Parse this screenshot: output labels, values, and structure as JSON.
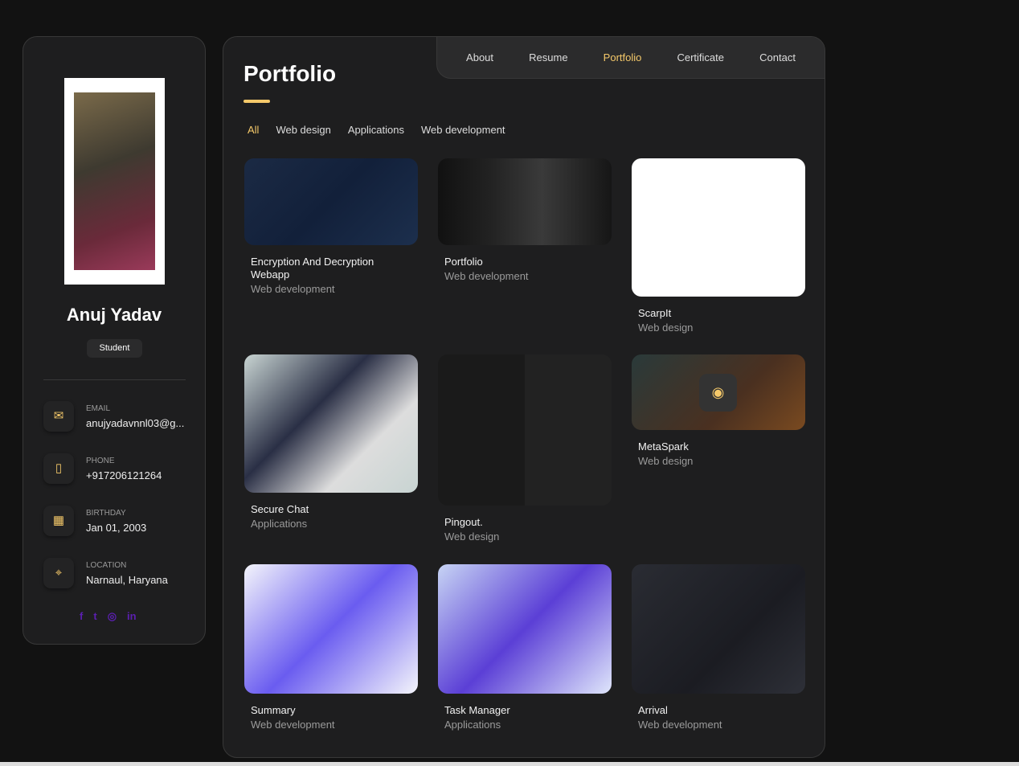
{
  "sidebar": {
    "name": "Anuj Yadav",
    "role": "Student",
    "contacts": [
      {
        "icon": "mail-icon",
        "glyph": "✉",
        "label": "EMAIL",
        "value": "anujyadavnnl03@g..."
      },
      {
        "icon": "phone-icon",
        "glyph": "▯",
        "label": "PHONE",
        "value": "+917206121264"
      },
      {
        "icon": "calendar-icon",
        "glyph": "▦",
        "label": "BIRTHDAY",
        "value": "Jan 01, 2003"
      },
      {
        "icon": "location-icon",
        "glyph": "⌖",
        "label": "LOCATION",
        "value": "Narnaul, Haryana"
      }
    ],
    "social": [
      {
        "icon": "facebook-icon",
        "glyph": "f"
      },
      {
        "icon": "twitter-icon",
        "glyph": "t"
      },
      {
        "icon": "instagram-icon",
        "glyph": "◎"
      },
      {
        "icon": "linkedin-icon",
        "glyph": "in"
      }
    ]
  },
  "nav": [
    "About",
    "Resume",
    "Portfolio",
    "Certificate",
    "Contact"
  ],
  "nav_active": "Portfolio",
  "title": "Portfolio",
  "filters": [
    "All",
    "Web design",
    "Applications",
    "Web development"
  ],
  "filter_active": "All",
  "accent": "#f5c96a",
  "projects": [
    {
      "title": "Encryption And Decryption Webapp",
      "category": "Web development"
    },
    {
      "title": "Portfolio",
      "category": "Web development"
    },
    {
      "title": "ScarpIt",
      "category": "Web design"
    },
    {
      "title": "Secure Chat",
      "category": "Applications"
    },
    {
      "title": "Pingout.",
      "category": "Web design"
    },
    {
      "title": "MetaSpark",
      "category": "Web design"
    },
    {
      "title": "Summary",
      "category": "Web development"
    },
    {
      "title": "Task Manager",
      "category": "Applications"
    },
    {
      "title": "Arrival",
      "category": "Web development"
    }
  ]
}
